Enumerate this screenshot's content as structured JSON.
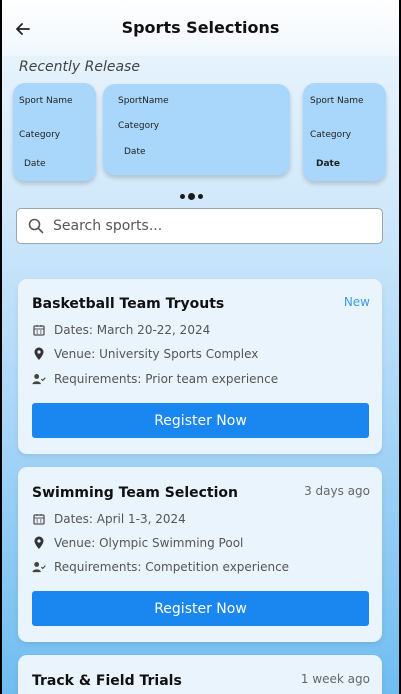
{
  "header": {
    "title": "Sports Selections"
  },
  "recent": {
    "label": "Recently Release",
    "cards": [
      {
        "name": "Sport Name",
        "category": "Category",
        "date": "Date"
      },
      {
        "name": "SportName",
        "category": "Category",
        "date": "Date"
      },
      {
        "name": "Sport Name",
        "category": "Category",
        "date": "Date"
      }
    ]
  },
  "search": {
    "placeholder": "Search sports..."
  },
  "tryouts": [
    {
      "title": "Basketball Team Tryouts",
      "tag": "New",
      "tag_color": "#3a9be6",
      "dates": "Dates: March 20-22, 2024",
      "venue": "Venue: University Sports Complex",
      "requirements": "Requirements: Prior team experience",
      "button": "Register Now"
    },
    {
      "title": "Swimming Team Selection",
      "tag": "3 days ago",
      "tag_color": "#666666",
      "dates": "Dates: April 1-3, 2024",
      "venue": "Venue: Olympic Swimming Pool",
      "requirements": "Requirements: Competition experience",
      "button": "Register Now"
    },
    {
      "title": "Track & Field Trials",
      "tag": "1 week ago",
      "tag_color": "#666666"
    }
  ],
  "colors": {
    "accent": "#1a86f0",
    "card": "#a9d7fb"
  }
}
